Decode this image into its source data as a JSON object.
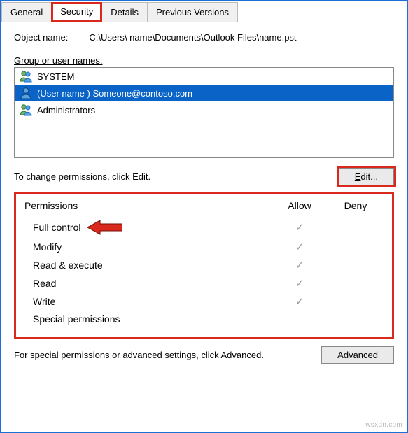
{
  "tabs": {
    "general": "General",
    "security": "Security",
    "details": "Details",
    "previous_versions": "Previous Versions"
  },
  "object_name_label": "Object name:",
  "object_name_value": "C:\\Users\\ name\\Documents\\Outlook Files\\name.pst",
  "group_label": "Group or user names:",
  "users": {
    "system": "SYSTEM",
    "selected": "(User name ) Someone@contoso.com",
    "administrators": "Administrators"
  },
  "change_text": "To change permissions, click Edit.",
  "edit_button_prefix": "E",
  "edit_button_rest": "dit...",
  "perm_header": "Permissions",
  "allow_header": "Allow",
  "deny_header": "Deny",
  "permissions": {
    "full_control": "Full control",
    "modify": "Modify",
    "read_execute": "Read & execute",
    "read": "Read",
    "write": "Write",
    "special": "Special permissions"
  },
  "adv_text": "For special permissions or advanced settings, click Advanced.",
  "adv_button": "Advanced",
  "watermark": "wsxdn.com"
}
